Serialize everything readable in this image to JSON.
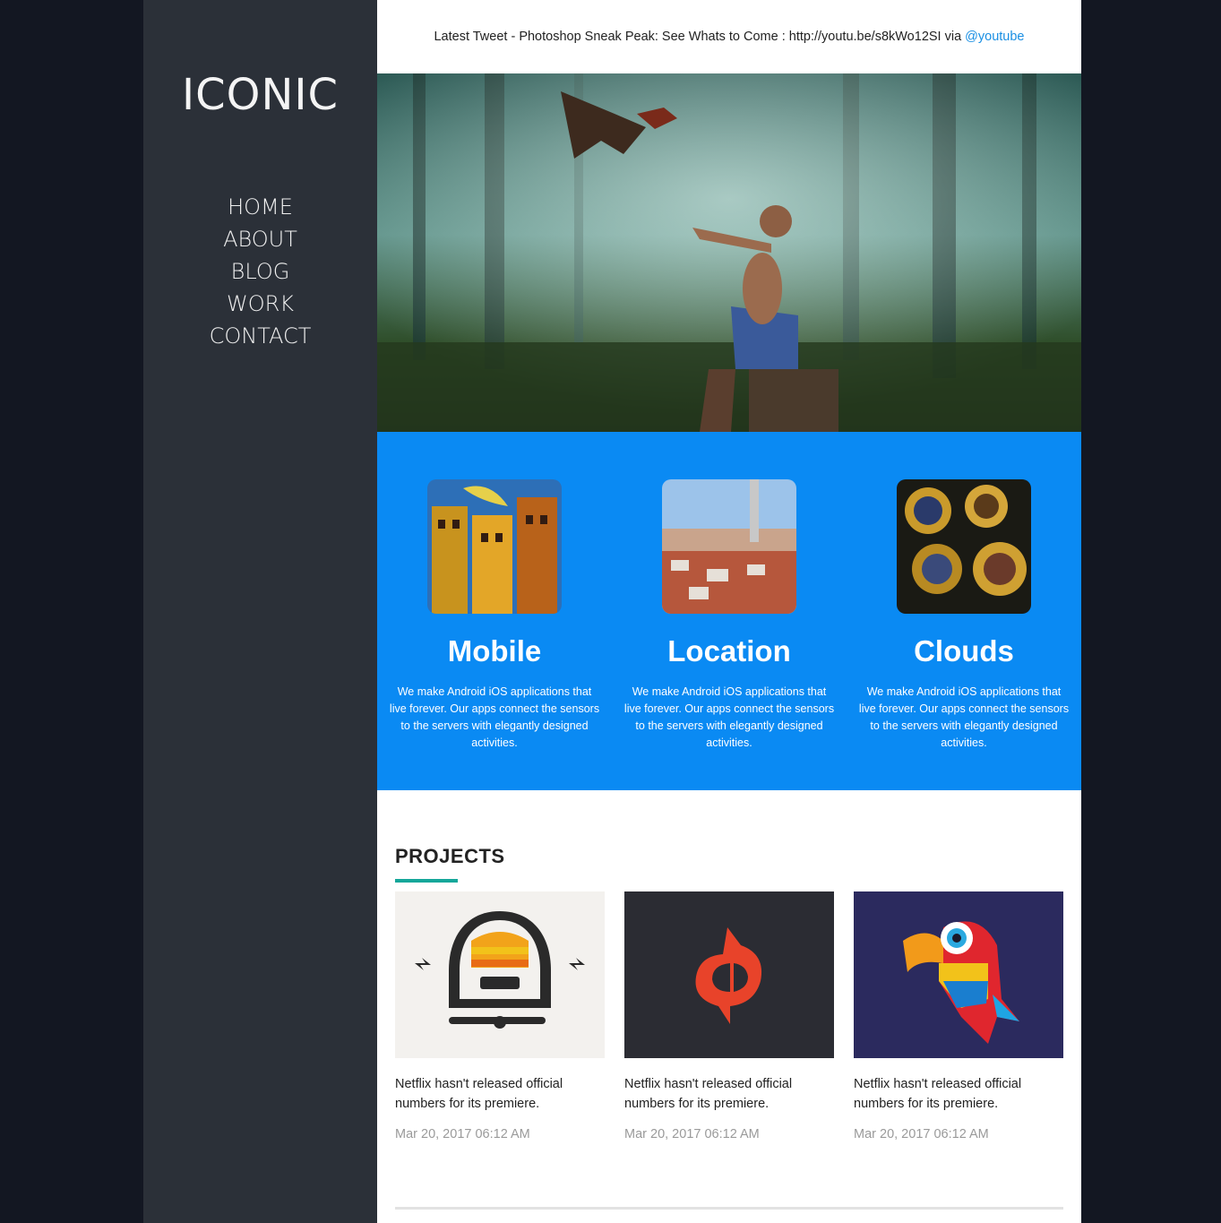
{
  "sidebar": {
    "logo": "ICONIC",
    "nav": [
      "HOME",
      "ABOUT",
      "BLOG",
      "WORK",
      "CONTACT"
    ]
  },
  "tweet": {
    "prefix": "Latest Tweet - Photoshop Sneak Peak: See Whats to Come : http://youtu.be/s8kWo12SI via ",
    "handle": "@youtube"
  },
  "services": [
    {
      "title": "Mobile",
      "text": "We make Android iOS applications that live forever. Our apps connect the sensors to the servers with elegantly designed activities."
    },
    {
      "title": "Location",
      "text": "We make Android iOS applications that live forever. Our apps connect the sensors to the servers with elegantly designed activities."
    },
    {
      "title": "Clouds",
      "text": "We make Android iOS applications that live forever. Our apps connect the sensors to the servers with elegantly designed activities."
    }
  ],
  "projects": {
    "title": "PROJECTS",
    "items": [
      {
        "text": "Netflix hasn't released official numbers for its premiere.",
        "date": "Mar 20, 2017 06:12 AM"
      },
      {
        "text": "Netflix hasn't released official numbers for its premiere.",
        "date": "Mar 20, 2017 06:12 AM"
      },
      {
        "text": "Netflix hasn't released official numbers for its premiere.",
        "date": "Mar 20, 2017 06:12 AM"
      }
    ]
  },
  "colors": {
    "accent": "#0a8af3",
    "sidebar": "#2b3038",
    "underline": "#14a79a",
    "link": "#1a8fe3"
  }
}
